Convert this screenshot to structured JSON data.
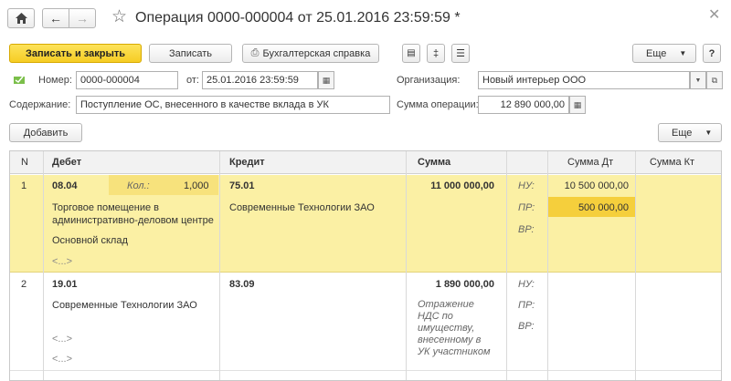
{
  "window": {
    "title": "Операция 0000-000004 от 25.01.2016 23:59:59 *"
  },
  "toolbar": {
    "save_close": "Записать и закрыть",
    "save": "Записать",
    "report": "Бухгалтерская справка",
    "more": "Еще"
  },
  "form": {
    "number_label": "Номер:",
    "number": "0000-000004",
    "date_label": "от:",
    "date": "25.01.2016 23:59:59",
    "org_label": "Организация:",
    "org": "Новый интерьер ООО",
    "content_label": "Содержание:",
    "content": "Поступление ОС, внесенного в качестве вклада в УК",
    "sum_label": "Сумма операции:",
    "sum": "12 890 000,00"
  },
  "table_toolbar": {
    "add": "Добавить",
    "more": "Еще"
  },
  "table": {
    "headers": {
      "n": "N",
      "debit": "Дебет",
      "credit": "Кредит",
      "sum": "Сумма",
      "sum_dt": "Сумма Дт",
      "sum_kt": "Сумма Кт"
    },
    "rows": [
      {
        "n": "1",
        "debit_account": "08.04",
        "qty_label": "Кол.:",
        "qty": "1,000",
        "debit_sub1a": "Торговое помещение в",
        "debit_sub1b": "административно-деловом центре",
        "debit_sub2": "Основной склад",
        "debit_sub3": "<...>",
        "credit_account": "75.01",
        "credit_sub1": "Современные Технологии ЗАО",
        "sum": "11 000 000,00",
        "nu": "НУ:",
        "pr": "ПР:",
        "vr": "ВР:",
        "sum_dt_nu": "10 500 000,00",
        "sum_dt_pr": "500 000,00"
      },
      {
        "n": "2",
        "debit_account": "19.01",
        "debit_sub1": "Современные Технологии ЗАО",
        "debit_sub2": "<...>",
        "debit_sub3": "<...>",
        "credit_account": "83.09",
        "sum": "1 890 000,00",
        "comment1": "Отражение",
        "comment2": "НДС по",
        "comment3": "имуществу,",
        "comment4": "внесенному в",
        "comment5": "УК участником",
        "nu": "НУ:",
        "pr": "ПР:",
        "vr": "ВР:"
      }
    ]
  },
  "colors": {
    "accent": "#f6cd24",
    "row_selected": "#fbf0a4",
    "cell_active": "#f5cf3c"
  }
}
